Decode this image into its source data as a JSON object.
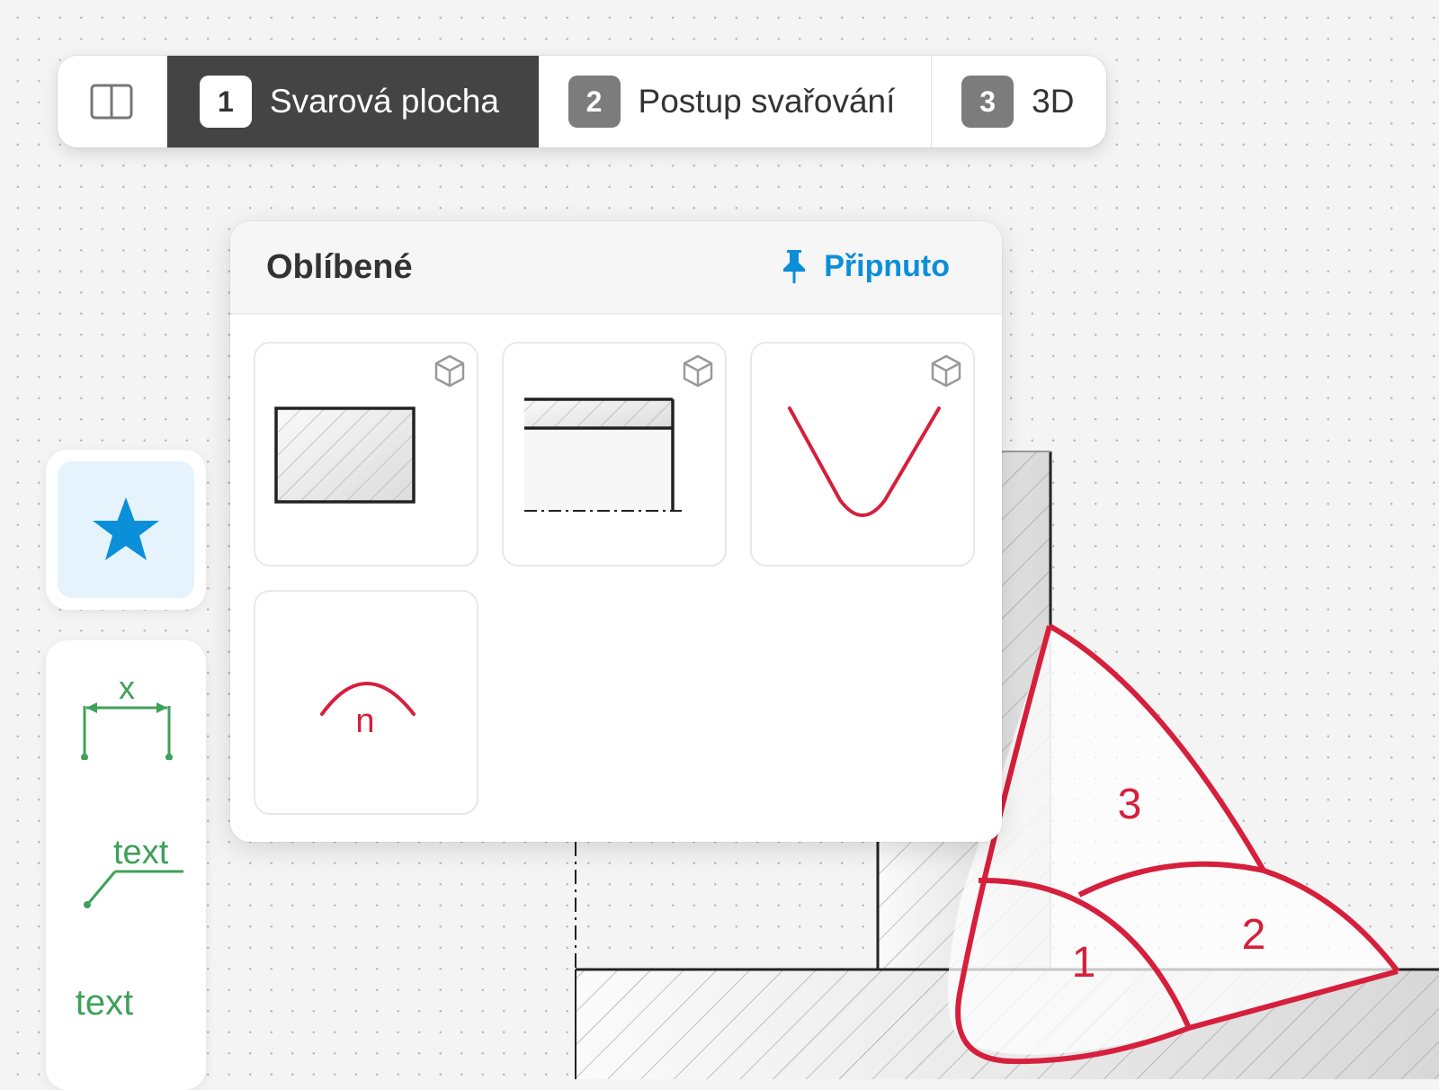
{
  "toolbar": {
    "tabs": [
      {
        "number": "1",
        "label": "Svarová plocha",
        "active": true
      },
      {
        "number": "2",
        "label": "Postup svařování",
        "active": false
      },
      {
        "number": "3",
        "label": "3D",
        "active": false
      }
    ]
  },
  "favorites_popup": {
    "title": "Oblíbené",
    "pin_label": "Připnuto",
    "cards": [
      {
        "name": "plate-section",
        "has_3d": true
      },
      {
        "name": "plate-with-centerline",
        "has_3d": true
      },
      {
        "name": "v-groove",
        "has_3d": true
      },
      {
        "name": "weld-cap",
        "label": "n",
        "has_3d": false
      }
    ]
  },
  "left_tools": {
    "dimension_label": "x",
    "leader_text_label": "text",
    "text_label": "text"
  },
  "drawing": {
    "weld_pass_labels": [
      "1",
      "2",
      "3"
    ]
  },
  "colors": {
    "accent": "#0b8fd8",
    "weld_red": "#d61f3c",
    "annotation_green": "#3fa05a",
    "active_tab": "#444444"
  }
}
